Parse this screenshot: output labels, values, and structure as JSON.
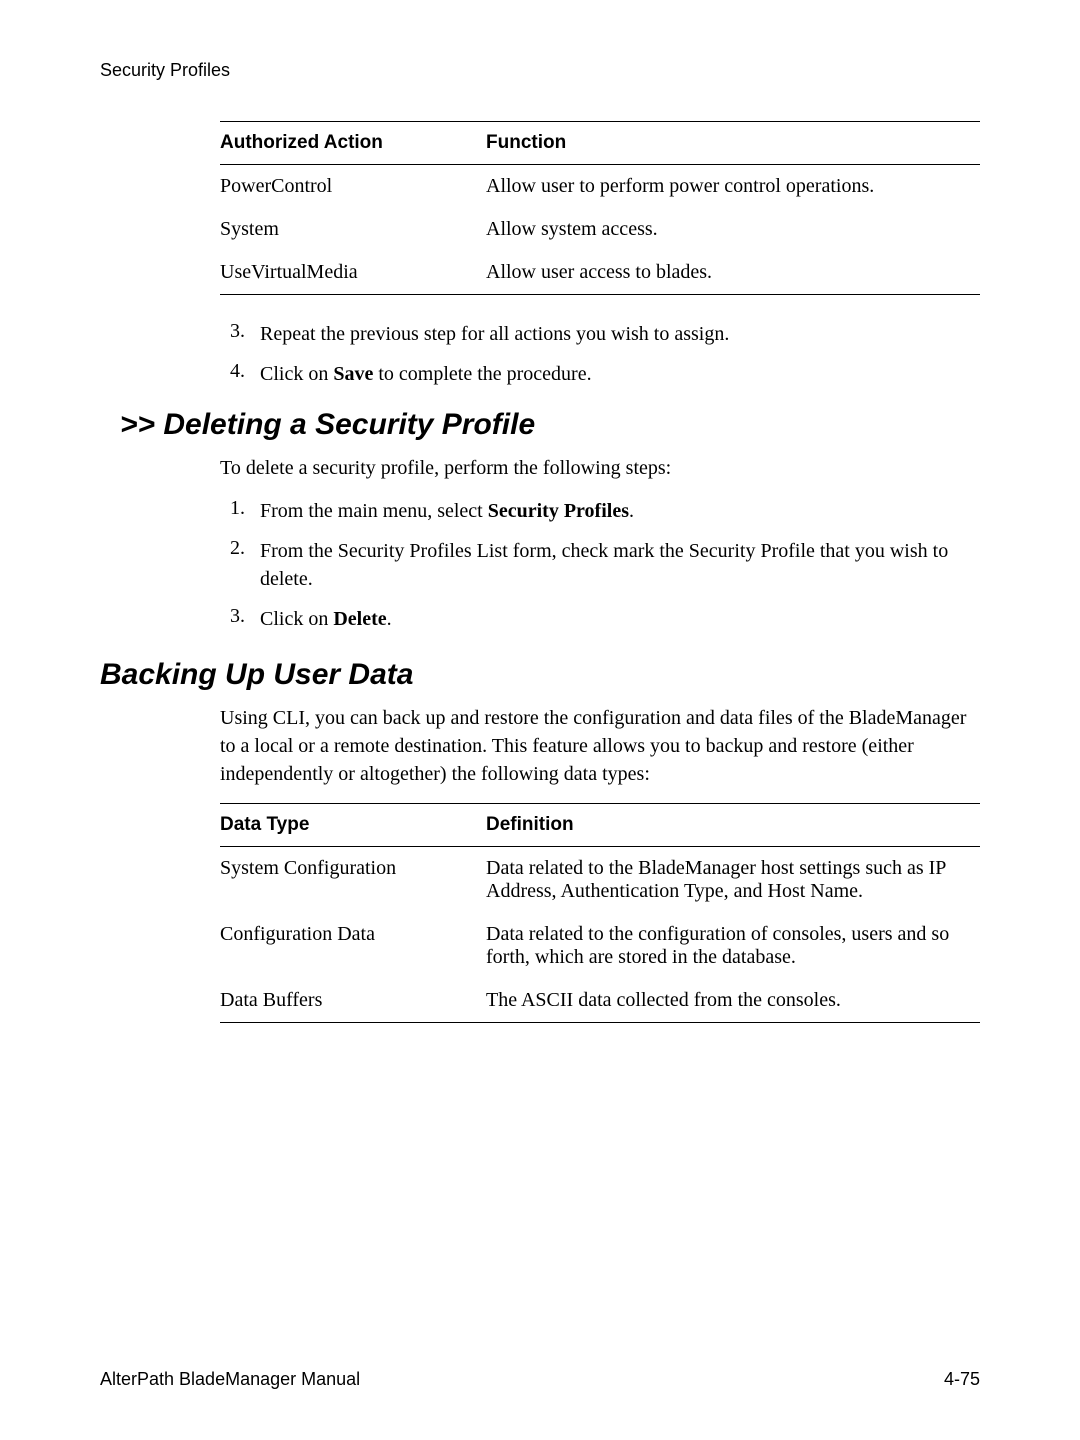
{
  "header": {
    "section_label": "Security Profiles"
  },
  "table1": {
    "headers": {
      "col1": "Authorized Action",
      "col2": "Function"
    },
    "rows": [
      {
        "col1": "PowerControl",
        "col2": "Allow user to perform power control operations."
      },
      {
        "col1": "System",
        "col2": "Allow system access."
      },
      {
        "col1": "UseVirtualMedia",
        "col2": "Allow user access to blades."
      }
    ]
  },
  "list1": {
    "items": [
      {
        "marker": "3.",
        "text_pre": "Repeat the previous step for all actions you wish to assign."
      },
      {
        "marker": "4.",
        "text_pre": "Click on ",
        "bold": "Save",
        "text_post": " to complete the procedure."
      }
    ]
  },
  "heading2_1": ">> Deleting a Security Profile",
  "para1": "To delete a security profile, perform the following steps:",
  "list2": {
    "items": [
      {
        "marker": "1.",
        "text_pre": "From the main menu, select ",
        "bold": "Security Profiles",
        "text_post": "."
      },
      {
        "marker": "2.",
        "text_pre": "From the Security Profiles List form, check mark the Security Profile that you wish to delete."
      },
      {
        "marker": "3.",
        "text_pre": "Click on ",
        "bold": "Delete",
        "text_post": "."
      }
    ]
  },
  "heading1_1": "Backing Up User Data",
  "para2": "Using CLI, you can back up and restore the configuration and data files of the BladeManager to a local or a remote destination. This feature allows you to backup and restore (either independently or altogether) the following data types:",
  "table2": {
    "headers": {
      "col1": "Data Type",
      "col2": "Definition"
    },
    "rows": [
      {
        "col1": "System Configuration",
        "col2": "Data related to the BladeManager host settings such as IP Address, Authentication Type, and Host Name."
      },
      {
        "col1": "Configuration Data",
        "col2": "Data related to the configuration of consoles, users and so forth, which are stored in the database."
      },
      {
        "col1": "Data Buffers",
        "col2": "The ASCII data collected from the consoles."
      }
    ]
  },
  "footer": {
    "left": "AlterPath BladeManager Manual",
    "right": "4-75"
  }
}
